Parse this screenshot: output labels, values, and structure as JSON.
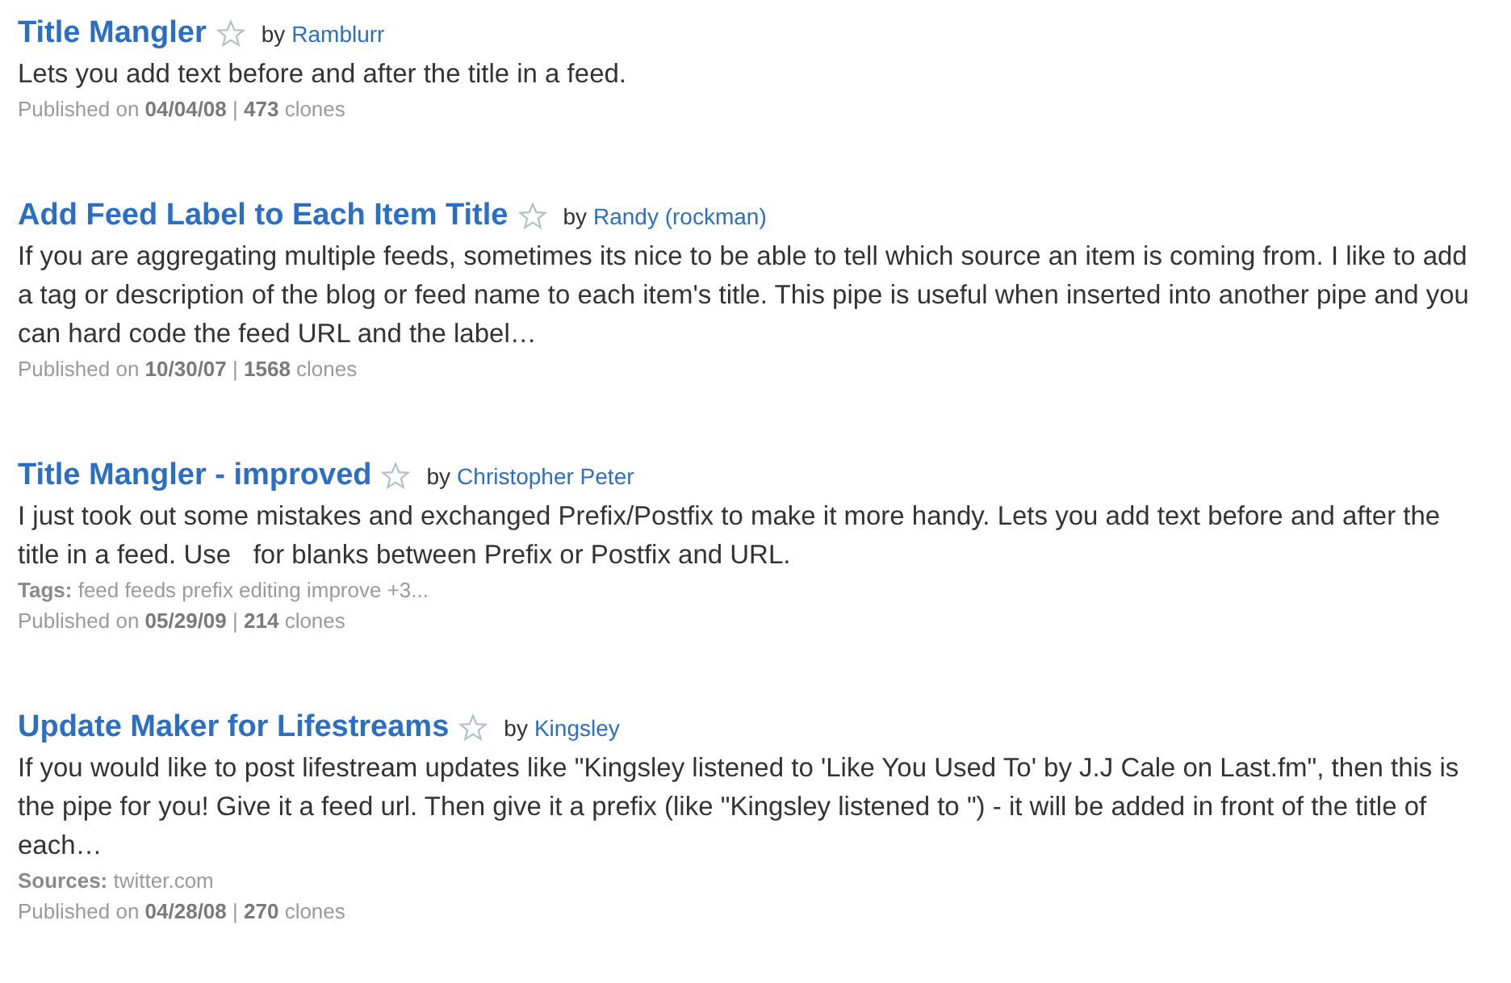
{
  "pipes": [
    {
      "title": "Title Mangler",
      "by": "by",
      "author": "Ramblurr",
      "description": "Lets you add text before and after the title in a feed.",
      "meta": "Published on **04/04/08** | **473** clones"
    },
    {
      "title": "Add Feed Label to Each Item Title",
      "by": "by",
      "author": "Randy (rockman)",
      "description": "If you are aggregating multiple feeds, sometimes its nice to be able to tell which source an item is coming from. I like to add a tag or description of the blog or feed name to each item's title. This pipe is useful when inserted into another pipe and you can hard code the feed URL and the label…",
      "meta": "Published on **10/30/07** | **1568** clones"
    },
    {
      "title": "Title Mangler - improved",
      "by": "by",
      "author": "Christopher Peter",
      "description": "I just took out some mistakes and exchanged Prefix/Postfix to make it more handy. Lets you add text before and after the title in a feed. Use   for blanks between Prefix or Postfix and URL.",
      "tags": "**Tags:** feed feeds prefix editing improve +3...",
      "meta": "Published on **05/29/09** | **214** clones"
    },
    {
      "title": "Update Maker for Lifestreams",
      "by": "by",
      "author": "Kingsley",
      "description": "If you would like to post lifestream updates like \"Kingsley listened to 'Like You Used To' by J.J Cale on Last.fm\", then this is the pipe for you! Give it a feed url. Then give it a prefix (like \"Kingsley listened to \") - it will be added in front of the title of each…",
      "sources": "**Sources:** twitter.com",
      "meta": "Published on **04/28/08** | **270** clones"
    }
  ]
}
